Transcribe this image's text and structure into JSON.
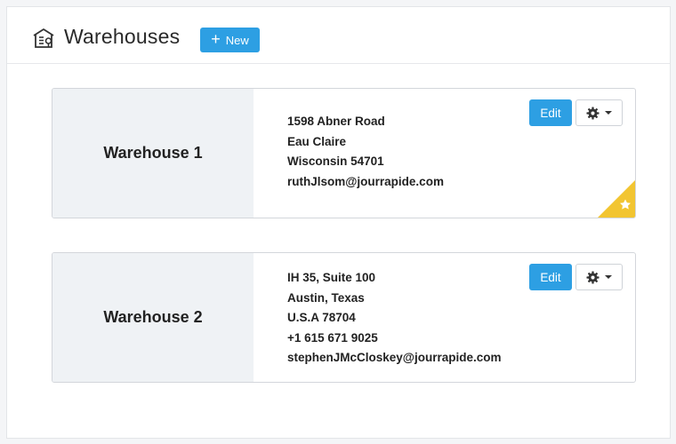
{
  "header": {
    "title": "Warehouses",
    "new_button_label": "New",
    "icon": "warehouse-icon"
  },
  "accent_color": "#2d9fe3",
  "default_badge_color": "#f2c531",
  "warehouses": [
    {
      "name": "Warehouse 1",
      "address_lines": [
        "1598 Abner Road",
        "Eau Claire",
        "Wisconsin 54701",
        "ruthJlsom@jourrapide.com"
      ],
      "edit_label": "Edit",
      "is_default": true
    },
    {
      "name": "Warehouse 2",
      "address_lines": [
        "IH 35, Suite 100",
        "Austin, Texas",
        "U.S.A 78704",
        "+1 615 671 9025",
        "stephenJMcCloskey@jourrapide.com"
      ],
      "edit_label": "Edit",
      "is_default": false
    }
  ]
}
